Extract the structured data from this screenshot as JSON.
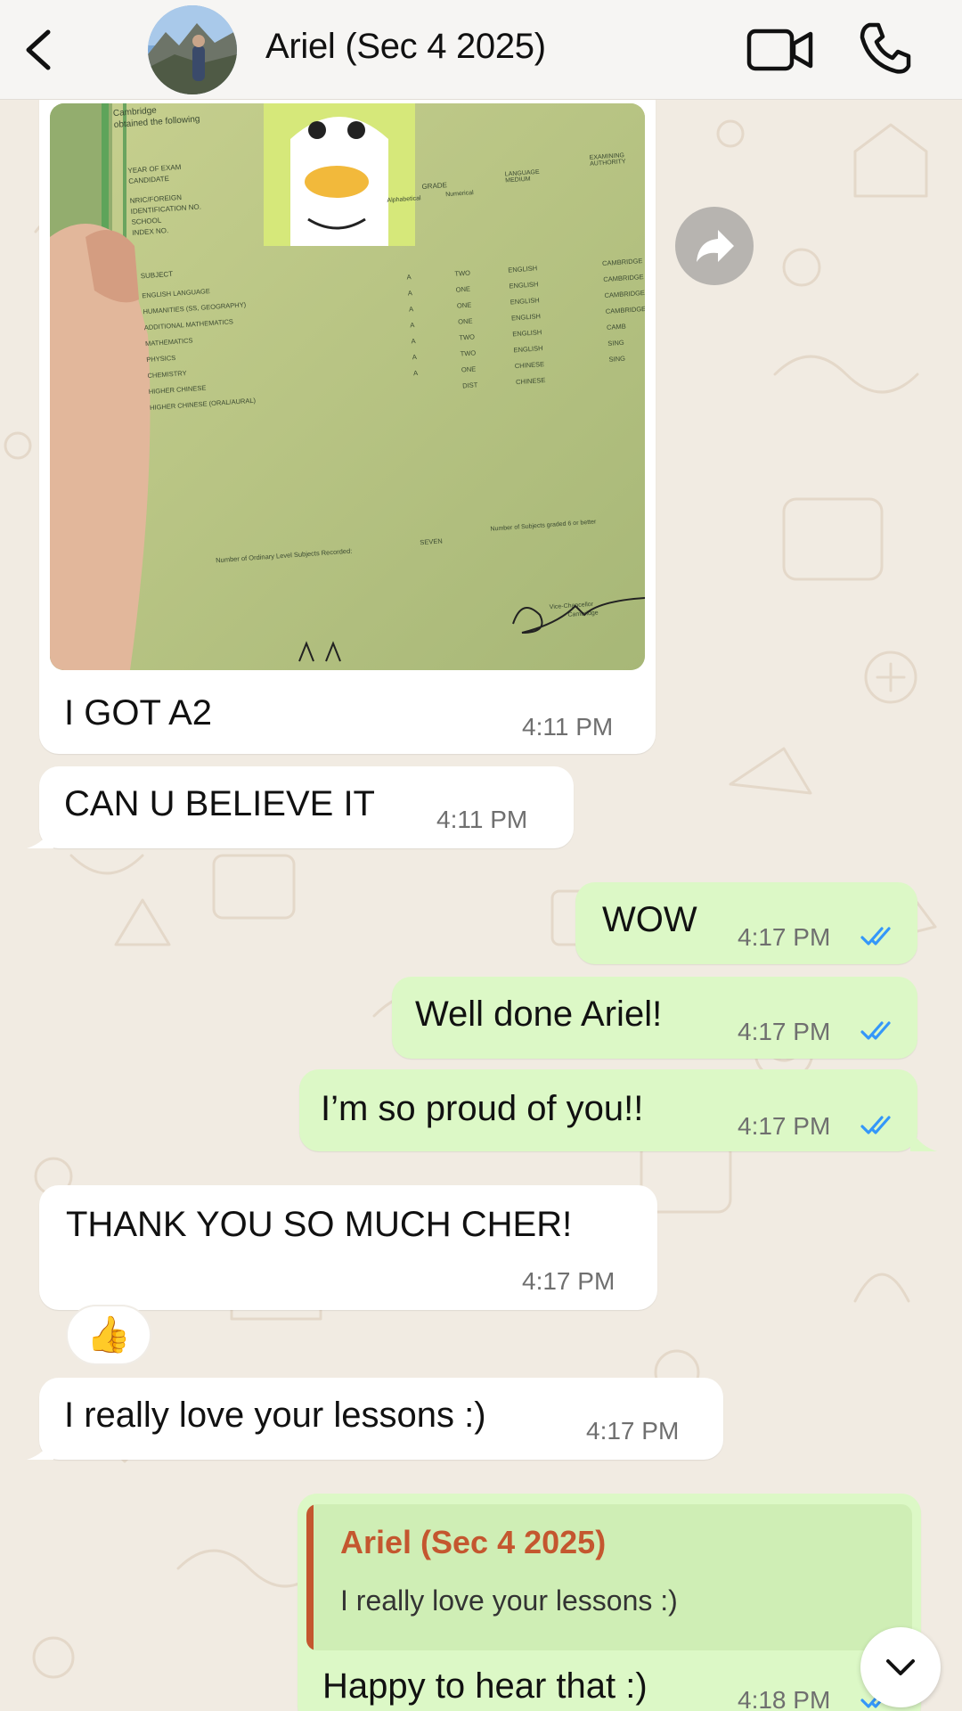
{
  "header": {
    "back_icon": "chevron-left-icon",
    "contact_name": "Ariel (Sec 4 2025)",
    "video_icon": "video-camera-icon",
    "call_icon": "phone-icon"
  },
  "photo_message": {
    "caption": "I GOT A2",
    "time": "4:11 PM",
    "certificate": {
      "header_lines": [
        "Cambridge",
        "obtained the following"
      ],
      "fields": [
        "YEAR OF EXAM",
        "CANDIDATE",
        "NRIC/FOREIGN",
        "IDENTIFICATION NO.",
        "SCHOOL",
        "INDEX NO."
      ],
      "col_grade": "GRADE",
      "col_alpha": "Alphabetical",
      "col_num": "Numerical",
      "col_lang": "LANGUAGE MEDIUM",
      "col_auth": "EXAMINING AUTHORITY",
      "subject_header": "SUBJECT",
      "subjects": [
        {
          "name": "ENGLISH LANGUAGE",
          "alpha": "A",
          "num": "TWO",
          "lang": "ENGLISH",
          "auth": "CAMBRIDGE"
        },
        {
          "name": "HUMANITIES (SS, GEOGRAPHY)",
          "alpha": "A",
          "num": "ONE",
          "lang": "ENGLISH",
          "auth": "CAMBRIDGE"
        },
        {
          "name": "ADDITIONAL MATHEMATICS",
          "alpha": "A",
          "num": "ONE",
          "lang": "ENGLISH",
          "auth": "CAMBRIDGE"
        },
        {
          "name": "MATHEMATICS",
          "alpha": "A",
          "num": "ONE",
          "lang": "ENGLISH",
          "auth": "CAMBRIDGE"
        },
        {
          "name": "PHYSICS",
          "alpha": "A",
          "num": "TWO",
          "lang": "ENGLISH",
          "auth": "CAMB"
        },
        {
          "name": "CHEMISTRY",
          "alpha": "A",
          "num": "TWO",
          "lang": "ENGLISH",
          "auth": "SING"
        },
        {
          "name": "HIGHER CHINESE",
          "alpha": "A",
          "num": "ONE",
          "lang": "CHINESE",
          "auth": "SING"
        },
        {
          "name": "HIGHER CHINESE (ORAL/AURAL)",
          "alpha": "",
          "num": "DIST",
          "lang": "CHINESE",
          "auth": ""
        }
      ],
      "footer_left": "Number of Ordinary Level Subjects Recorded:",
      "footer_count": "SEVEN",
      "footer_right": "Number of Subjects graded 6 or better",
      "signature_role": "Vice-Chancellor",
      "signature_org": "Cambridge"
    }
  },
  "messages": [
    {
      "id": "m2",
      "direction": "in",
      "text": "CAN U BELIEVE IT",
      "time": "4:11 PM"
    },
    {
      "id": "m3",
      "direction": "out",
      "text": "WOW",
      "time": "4:17 PM",
      "status": "read"
    },
    {
      "id": "m4",
      "direction": "out",
      "text": "Well done Ariel!",
      "time": "4:17 PM",
      "status": "read"
    },
    {
      "id": "m5",
      "direction": "out",
      "text": "I’m so proud of you!!",
      "time": "4:17 PM",
      "status": "read"
    },
    {
      "id": "m6",
      "direction": "in",
      "text": "THANK YOU SO MUCH CHER!",
      "time": "4:17 PM"
    },
    {
      "id": "m7",
      "direction": "in",
      "text": "I really love your lessons :)",
      "time": "4:17 PM"
    },
    {
      "id": "m8",
      "direction": "out",
      "text": "Happy to hear that :)",
      "time": "4:18 PM",
      "status": "read"
    }
  ],
  "reaction": {
    "emoji": "👍",
    "icon": "thumbs-up-icon"
  },
  "reply_quote": {
    "name": "Ariel (Sec 4 2025)",
    "text": "I really love your lessons :)"
  },
  "colors": {
    "chat_background": "#f1ebe2",
    "incoming_bubble": "#ffffff",
    "outgoing_bubble": "#dcf8c6",
    "read_ticks": "#3497f9",
    "quote_accent": "#c4572f"
  }
}
